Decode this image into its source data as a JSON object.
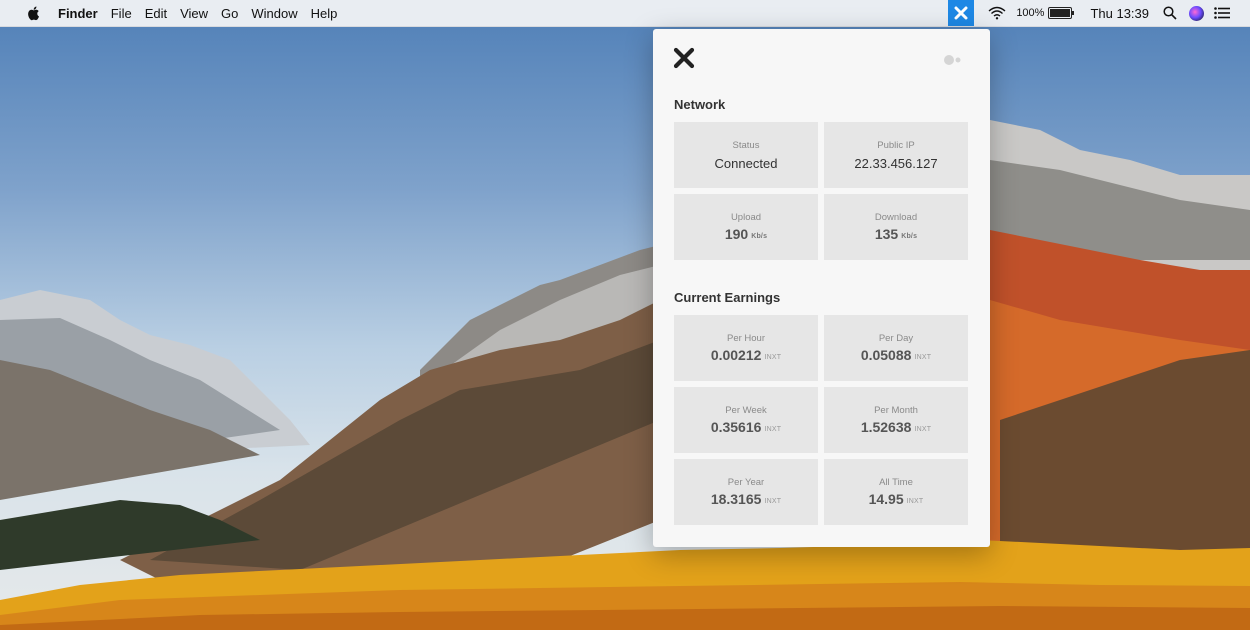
{
  "menubar": {
    "app_name": "Finder",
    "menus": [
      "File",
      "Edit",
      "View",
      "Go",
      "Window",
      "Help"
    ],
    "battery_percent": "100%",
    "clock": "Thu 13:39",
    "icons": [
      "apple-icon",
      "x-extra-icon",
      "wifi-icon",
      "battery-icon",
      "spotlight-icon",
      "siri-icon",
      "notification-center-icon"
    ]
  },
  "panel": {
    "network": {
      "title": "Network",
      "status": {
        "label": "Status",
        "value": "Connected"
      },
      "public_ip": {
        "label": "Public IP",
        "value": "22.33.456.127"
      },
      "upload": {
        "label": "Upload",
        "value": "190",
        "unit": "Kb/s"
      },
      "download": {
        "label": "Download",
        "value": "135",
        "unit": "Kb/s"
      }
    },
    "earnings": {
      "title": "Current Earnings",
      "per_hour": {
        "label": "Per Hour",
        "value": "0.00212",
        "unit": "INXT"
      },
      "per_day": {
        "label": "Per Day",
        "value": "0.05088",
        "unit": "INXT"
      },
      "per_week": {
        "label": "Per Week",
        "value": "0.35616",
        "unit": "INXT"
      },
      "per_month": {
        "label": "Per Month",
        "value": "1.52638",
        "unit": "INXT"
      },
      "per_year": {
        "label": "Per Year",
        "value": "18.3165",
        "unit": "INXT"
      },
      "all_time": {
        "label": "All Time",
        "value": "14.95",
        "unit": "INXT"
      }
    }
  },
  "colors": {
    "accent": "#1e88e5",
    "tile_bg": "#e6e6e6",
    "panel_bg": "#f7f7f7"
  }
}
